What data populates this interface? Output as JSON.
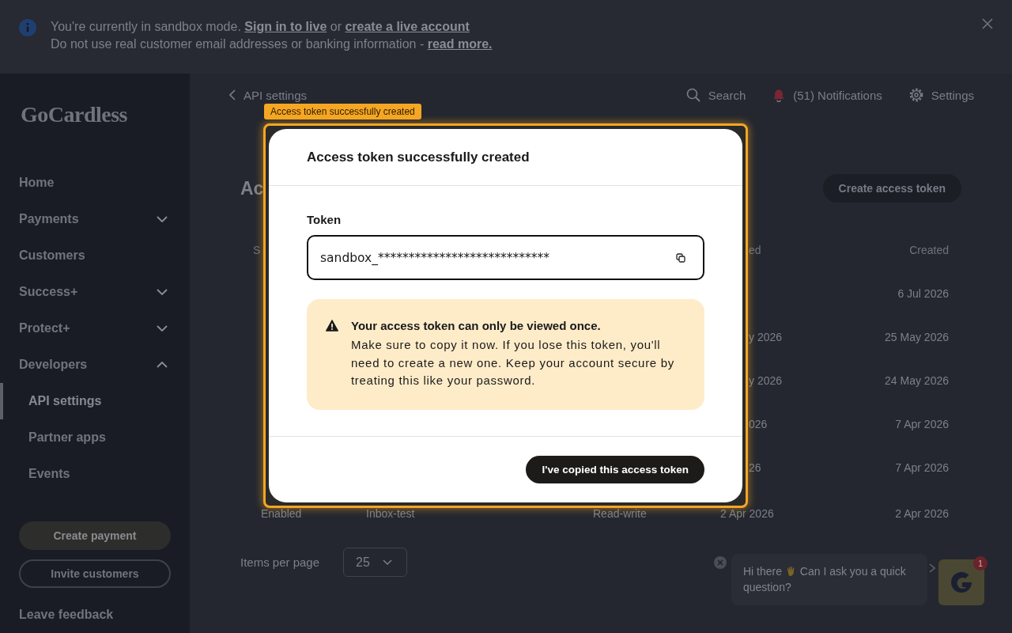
{
  "banner": {
    "lines": [
      [
        {
          "kind": "text",
          "text": "You're currently in sandbox mode."
        },
        {
          "kind": "link",
          "text": "Sign in to live"
        },
        {
          "kind": "text",
          "text": "or"
        },
        {
          "kind": "link",
          "text": "create a live account"
        }
      ],
      [
        {
          "kind": "text",
          "text": "Do not use real customer email addresses or banking information -"
        },
        {
          "kind": "link",
          "text": "read more."
        }
      ]
    ]
  },
  "sidebar": {
    "logo": "GoCardless",
    "nav": [
      {
        "label": "Home",
        "selected": false
      },
      {
        "label": "Payments",
        "selected": false,
        "expanded": false
      },
      {
        "label": "Customers",
        "selected": false
      },
      {
        "label": "Success+",
        "selected": false,
        "expanded": false
      },
      {
        "label": "Protect+",
        "selected": false,
        "expanded": false
      },
      {
        "label": "Developers",
        "selected": false,
        "expanded": true,
        "children": [
          {
            "label": "API settings",
            "selected": true
          },
          {
            "label": "Partner apps",
            "selected": false
          },
          {
            "label": "Events",
            "selected": false
          }
        ]
      }
    ],
    "buttons": [
      {
        "label": "Create payment",
        "kind": "primary"
      },
      {
        "label": "Invite customers",
        "kind": "outline"
      }
    ],
    "feedback_link": "Leave feedback"
  },
  "header": {
    "back_link": "API settings",
    "actions": [
      {
        "label": "Search",
        "kind": "search"
      },
      {
        "label": "(51) Notifications",
        "kind": "notifications"
      },
      {
        "label": "Settings",
        "kind": "settings"
      }
    ]
  },
  "page": {
    "heading": "Ac",
    "create_button": "Create access token",
    "table": {
      "header": {
        "column_1": "S",
        "column_4": "ed",
        "created": "Created"
      },
      "rows": [
        {
          "created": "6 Jul 2026"
        },
        {
          "column_4": "y 2026",
          "created": "25 May 2026"
        },
        {
          "column_4": "y 2026",
          "created": "24 May 2026"
        },
        {
          "column_4": "026",
          "created": "7 Apr 2026"
        },
        {
          "column_4": "26",
          "created": "7 Apr 2026"
        },
        {
          "column_1": "Enabled",
          "column_2": "Inbox-test",
          "column_3": "Read-write",
          "column_4": "2 Apr 2026",
          "created": "2 Apr 2026"
        }
      ]
    },
    "pagination": {
      "label": "Items per page",
      "page_size": "25"
    }
  },
  "chat": {
    "message_start": "Hi there",
    "message_end": "Can I ask you a quick question?",
    "unread_count": "1"
  },
  "highlight": {
    "label": "Access token successfully created"
  },
  "dialog": {
    "title": "Access token successfully created",
    "field": {
      "label": "Token",
      "value": "sandbox_****************************"
    },
    "warning": {
      "title": "Your access token can only be viewed once.",
      "body": "Make sure to copy it now. If you lose this token, you'll need to create a new one. Keep your account secure by treating this like your password."
    },
    "button": "I've copied this access token"
  }
}
